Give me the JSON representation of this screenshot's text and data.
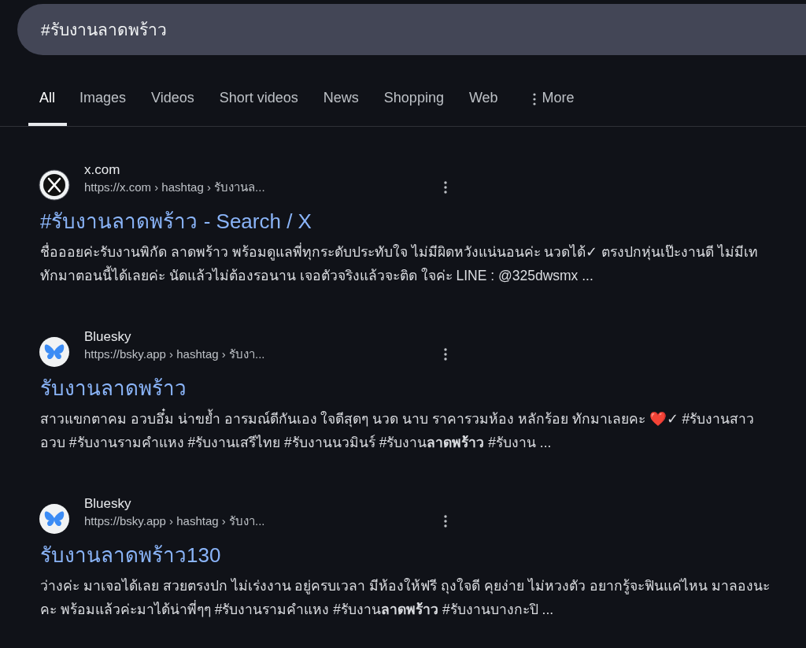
{
  "search": {
    "value": "#รับงานลาดพร้าว"
  },
  "tabs": [
    {
      "label": "All",
      "selected": true,
      "kind": "plain"
    },
    {
      "label": "Images",
      "selected": false,
      "kind": "plain"
    },
    {
      "label": "Videos",
      "selected": false,
      "kind": "plain"
    },
    {
      "label": "Short videos",
      "selected": false,
      "kind": "plain"
    },
    {
      "label": "News",
      "selected": false,
      "kind": "plain"
    },
    {
      "label": "Shopping",
      "selected": false,
      "kind": "plain"
    },
    {
      "label": "Web",
      "selected": false,
      "kind": "plain"
    },
    {
      "label": "More",
      "selected": false,
      "kind": "more"
    }
  ],
  "results": [
    {
      "kind": "x",
      "site": "x.com",
      "url": "https://x.com › hashtag › รับงานล...",
      "title": "#รับงานลาดพร้าว - Search / X",
      "snippet": "ชื่อออยค่ะรับงานพิกัด ลาดพร้าว พร้อมดูแลพี่ทุกระดับประทับใจ ไม่มีผิดหวังแน่นอนค่ะ นวดได้✓ ตรงปกหุ่นเป๊ะงานดี ไม่มีเท ทักมาตอนนี้ได้เลยค่ะ นัดแล้วไม่ต้องรอนาน เจอตัวจริงแล้วจะติด ใจค่ะ LINE : @325dwsmx ..."
    },
    {
      "kind": "bluesky",
      "site": "Bluesky",
      "url": "https://bsky.app › hashtag › รับงา...",
      "title": "รับงานลาดพร้าว",
      "snippet": "สาวแขกตาคม อวบอึ๋ม น่าขย้ำ อารมณ์ดีกันเอง ใจดีสุดๆ นวด นาบ ราคารวมห้อง หลักร้อย ทักมาเลยคะ ❤️✓ #รับงานสาวอวบ #รับงานรามคำแหง #รับงานเสรีไทย #รับงานนวมินร์ #รับงาน**ลาดพร้าว** #รับงาน ..."
    },
    {
      "kind": "bluesky",
      "site": "Bluesky",
      "url": "https://bsky.app › hashtag › รับงา...",
      "title": "รับงานลาดพร้าว130",
      "snippet": "ว่างค่ะ มาเจอได้เลย สวยตรงปก ไม่เร่งงาน อยู่ครบเวลา มีห้องให้ฟรี ถุงใจดี คุยง่าย ไม่หวงตัว อยากรู้จะฟินแค่ไหน มาลองนะคะ พร้อมแล้วค่ะมาได้น่าพี่ๆๆ #รับงานรามคำแหง #รับงาน**ลาดพร้าว** #รับงานบางกะปิ ..."
    }
  ]
}
